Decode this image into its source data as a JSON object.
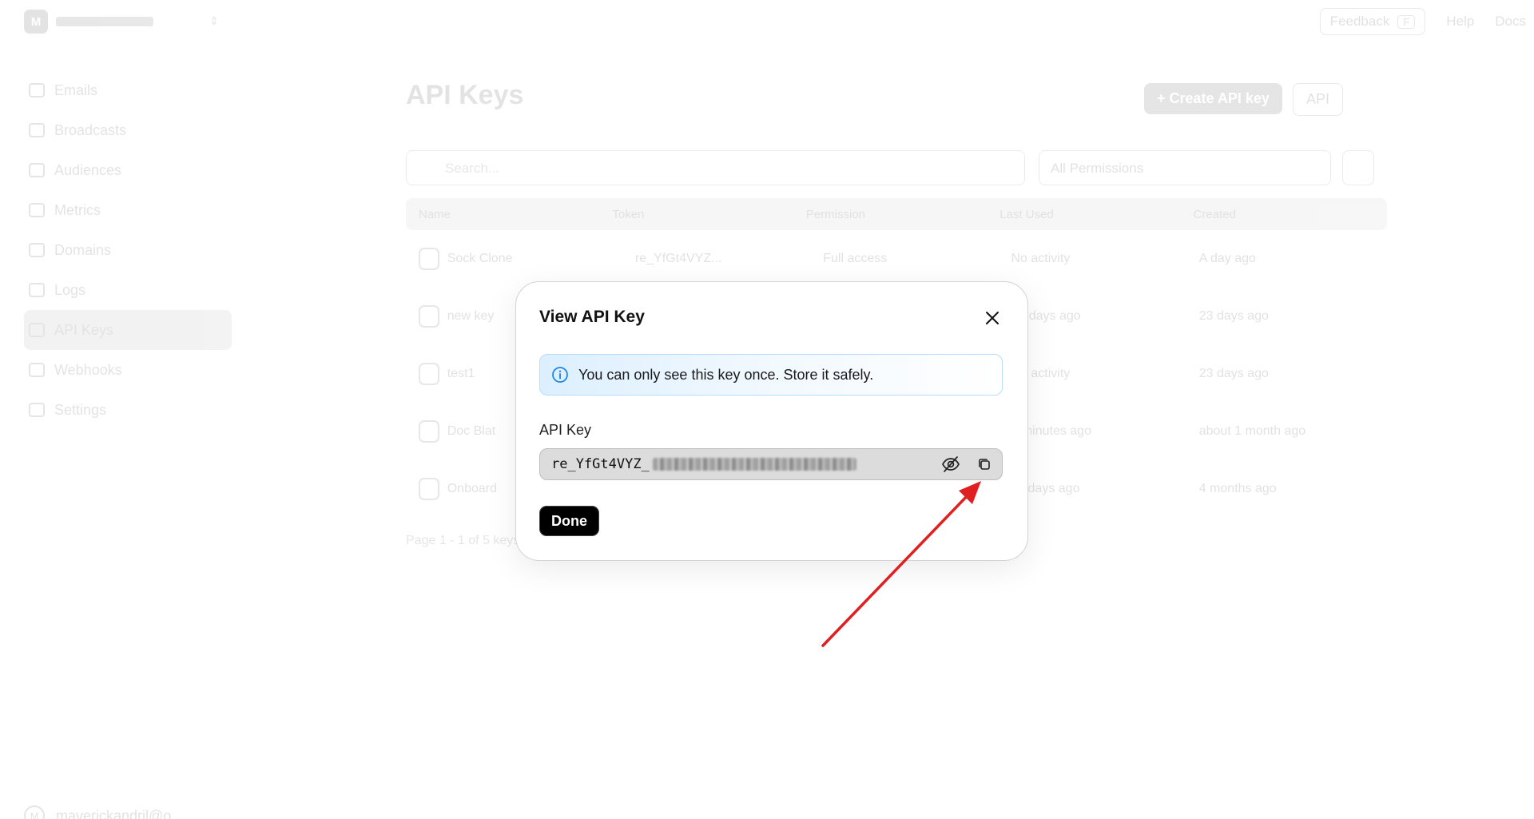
{
  "background": {
    "team": {
      "logo_letter": "M"
    },
    "nav": [
      {
        "label": "Emails",
        "icon": "mail-icon"
      },
      {
        "label": "Broadcasts",
        "icon": "broadcast-icon"
      },
      {
        "label": "Audiences",
        "icon": "users-icon"
      },
      {
        "label": "Metrics",
        "icon": "chart-icon"
      },
      {
        "label": "Domains",
        "icon": "globe-icon"
      },
      {
        "label": "Logs",
        "icon": "logs-icon"
      },
      {
        "label": "API Keys",
        "icon": "lock-icon"
      },
      {
        "label": "Webhooks",
        "icon": "webhook-icon"
      },
      {
        "label": "Settings",
        "icon": "settings-icon"
      }
    ],
    "user": {
      "avatar_letter": "M",
      "name": "maverickandril@o"
    },
    "topbar": {
      "feedback": "Feedback",
      "feedback_key": "F",
      "help": "Help",
      "docs": "Docs"
    },
    "page_title": "API Keys",
    "create_button": "+ Create API key",
    "api_button": "API",
    "search_placeholder": "Search...",
    "permission_filter": "All Permissions",
    "table": {
      "headers": [
        "Name",
        "Token",
        "Permission",
        "Last Used",
        "Created"
      ],
      "rows": [
        {
          "name": "Sock Clone",
          "token": "re_YfGt4VYZ...",
          "permission": "Full access",
          "last_used": "No activity",
          "created": "A day ago"
        },
        {
          "name": "new key",
          "token": "",
          "permission": "",
          "last_used": "23 days ago",
          "created": "23 days ago"
        },
        {
          "name": "test1",
          "token": "",
          "permission": "",
          "last_used": "No activity",
          "created": "23 days ago"
        },
        {
          "name": "Doc Blat",
          "token": "",
          "permission": "",
          "last_used": "3 minutes ago",
          "created": "about 1 month ago"
        },
        {
          "name": "Onboard",
          "token": "",
          "permission": "",
          "last_used": "11 days ago",
          "created": "4 months ago"
        }
      ]
    },
    "pager": "Page 1 - 1 of 5 keys"
  },
  "modal": {
    "title": "View API Key",
    "info_text": "You can only see this key once. Store it safely.",
    "field_label": "API Key",
    "key_visible_prefix": "re_YfGt4VYZ_",
    "done_label": "Done"
  },
  "colors": {
    "info_border": "#b8dcff",
    "info_icon": "#1e88e5",
    "arrow": "#e02020",
    "done_bg": "#000000"
  }
}
